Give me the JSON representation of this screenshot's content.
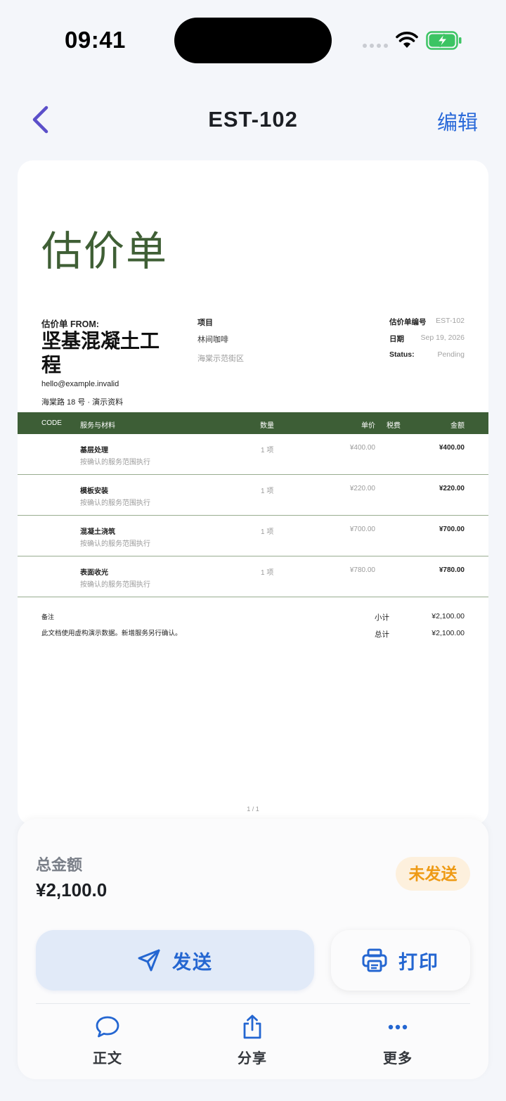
{
  "status_bar": {
    "time": "09:41"
  },
  "nav": {
    "title": "EST-102",
    "edit_label": "编辑"
  },
  "document": {
    "heading": "估价单",
    "from_label": "估价单 FROM:",
    "company": "坚基混凝土工程",
    "email": "hello@example.invalid",
    "address": "海棠路 18 号 · 演示资料",
    "project_label": "项目",
    "project_name": "林间咖啡",
    "project_address": "海棠示范街区",
    "meta": [
      {
        "key": "估价单编号",
        "value": "EST-102"
      },
      {
        "key": "日期",
        "value": "Sep 19, 2026"
      },
      {
        "key": "Status:",
        "value": "Pending"
      }
    ],
    "table_headers": {
      "code": "CODE",
      "desc": "服务与材料",
      "qty": "数量",
      "price": "单价",
      "tax": "税费",
      "amount": "金额"
    },
    "items": [
      {
        "name": "基层处理",
        "note": "按确认的服务范围执行",
        "qty": "1 项",
        "price": "¥400.00",
        "amount": "¥400.00"
      },
      {
        "name": "模板安装",
        "note": "按确认的服务范围执行",
        "qty": "1 项",
        "price": "¥220.00",
        "amount": "¥220.00"
      },
      {
        "name": "混凝土浇筑",
        "note": "按确认的服务范围执行",
        "qty": "1 项",
        "price": "¥700.00",
        "amount": "¥700.00"
      },
      {
        "name": "表面收光",
        "note": "按确认的服务范围执行",
        "qty": "1 项",
        "price": "¥780.00",
        "amount": "¥780.00"
      }
    ],
    "notes_label": "备注",
    "notes_text": "此文档使用虚构演示数据。新增服务另行确认。",
    "subtotal_label": "小计",
    "subtotal_value": "¥2,100.00",
    "total_label": "总计",
    "total_value": "¥2,100.00",
    "page_indicator": "1 / 1"
  },
  "sheet": {
    "total_label": "总金额",
    "total_value": "¥2,100.0",
    "status_badge": "未发送",
    "send_label": "发送",
    "print_label": "打印",
    "tabs": [
      {
        "label": "正文",
        "icon": "chat-bubble-icon"
      },
      {
        "label": "分享",
        "icon": "share-icon"
      },
      {
        "label": "更多",
        "icon": "more-dots-icon"
      }
    ]
  },
  "colors": {
    "accent": "#2466d1",
    "doc_green": "#3d5e36",
    "badge_bg": "#fdf0dd",
    "badge_text": "#ee9a14",
    "back_chevron": "#5b4fc9"
  }
}
